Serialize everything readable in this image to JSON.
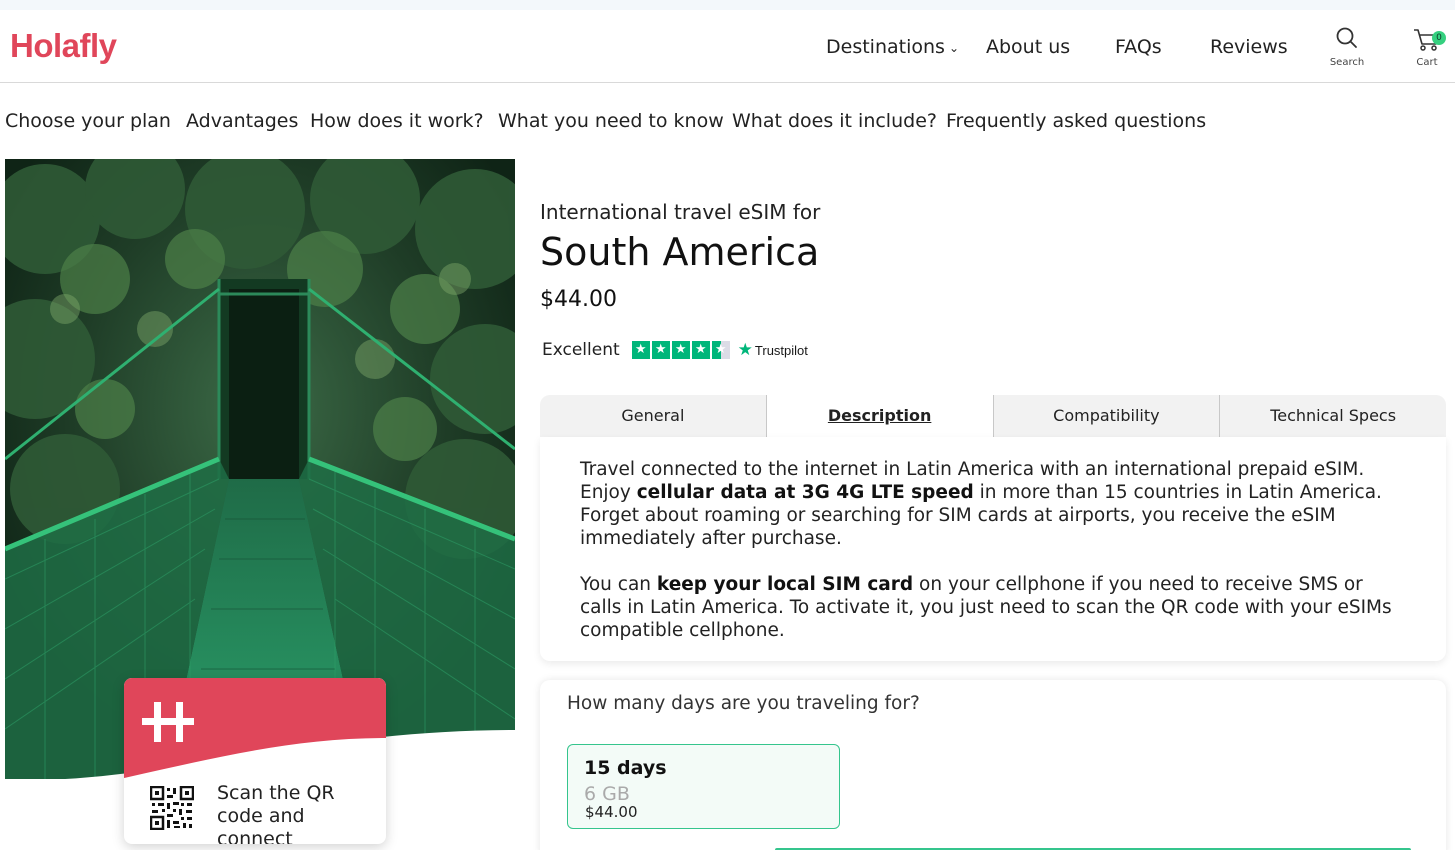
{
  "header": {
    "logo": "Holafly",
    "nav": {
      "destinations": "Destinations",
      "about": "About us",
      "faqs": "FAQs",
      "reviews": "Reviews"
    },
    "search_label": "Search",
    "cart_label": "Cart",
    "cart_count": "0"
  },
  "subnav": {
    "items": [
      "Choose your plan",
      "Advantages",
      "How does it work?",
      "What you need to know",
      "What does it include?",
      "Frequently asked questions"
    ]
  },
  "esim_card": {
    "text": "Scan the QR code and connect"
  },
  "product": {
    "subtitle": "International travel eSIM for",
    "title": "South America",
    "price": "$44.00",
    "rating_label": "Excellent",
    "rating_stars": 4.5,
    "trustpilot": "Trustpilot"
  },
  "tabs": {
    "general": "General",
    "description": "Description",
    "compatibility": "Compatibility",
    "specs": "Technical Specs"
  },
  "description": {
    "p1_a": "Travel connected to the internet in Latin America with an international prepaid eSIM. Enjoy ",
    "p1_b": "cellular data at 3G 4G LTE speed",
    "p1_c": " in more than 15 countries in Latin America. Forget about roaming or searching for SIM cards at airports, you receive the eSIM immediately after purchase.",
    "p2_a": "You can ",
    "p2_b": "keep your local SIM card",
    "p2_c": " on your cellphone if you need to receive SMS or calls in Latin America. To activate it, you just need to scan the QR code with your eSIMs compatible cellphone."
  },
  "plans": {
    "question": "How many days are you traveling for?",
    "selected": {
      "days": "15 days",
      "data": "6 GB",
      "price": "$44.00"
    }
  },
  "colors": {
    "brand": "#e0465a",
    "accent_green": "#35c58d",
    "trustpilot_green": "#00b67a"
  }
}
